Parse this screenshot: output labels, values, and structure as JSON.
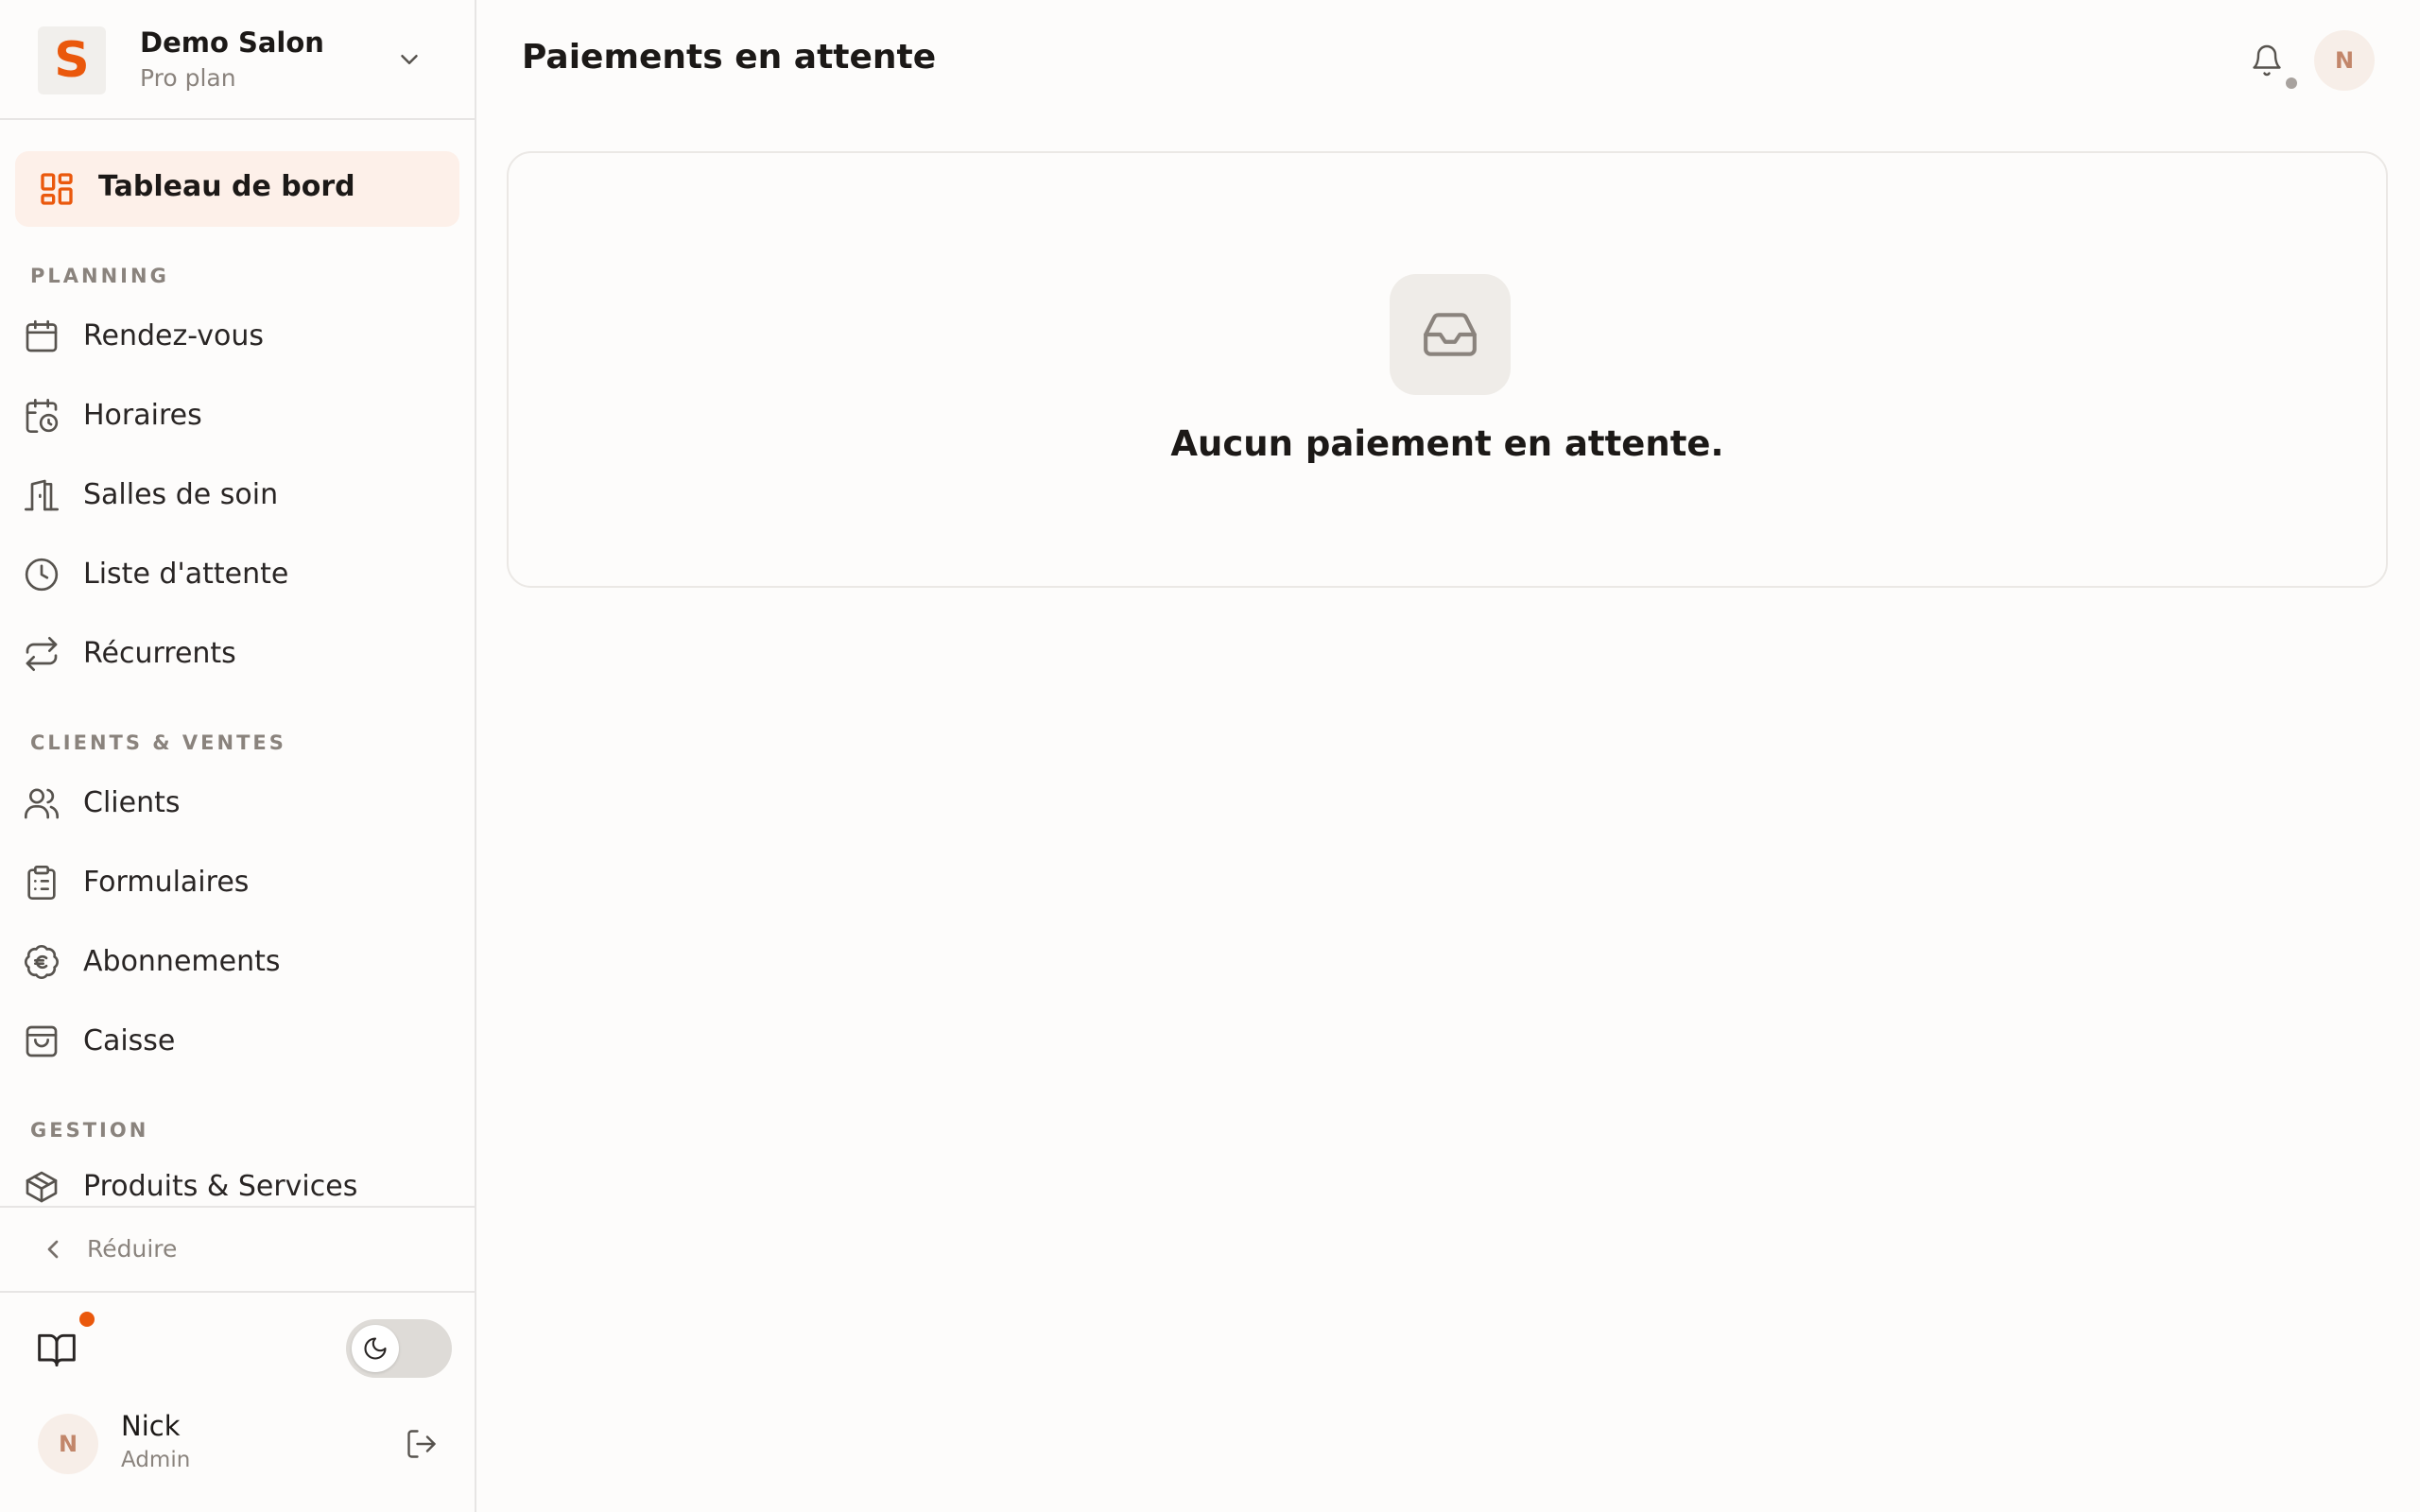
{
  "colors": {
    "accent": "#ea580c",
    "active_bg": "#fdf0e9",
    "muted_text": "#8a837d",
    "border": "#e7e5e4"
  },
  "brand": {
    "logo_letter": "S",
    "name": "Demo Salon",
    "plan": "Pro plan",
    "chevron_icon": "chevron-down-icon"
  },
  "sidebar": {
    "active_item": {
      "label": "Tableau de bord",
      "icon": "dashboard-icon"
    },
    "sections": [
      {
        "title": "PLANNING",
        "items": [
          {
            "label": "Rendez-vous",
            "icon": "calendar-icon"
          },
          {
            "label": "Horaires",
            "icon": "calendar-clock-icon"
          },
          {
            "label": "Salles de soin",
            "icon": "door-icon"
          },
          {
            "label": "Liste d'attente",
            "icon": "clock-icon"
          },
          {
            "label": "Récurrents",
            "icon": "repeat-icon"
          }
        ]
      },
      {
        "title": "CLIENTS & VENTES",
        "items": [
          {
            "label": "Clients",
            "icon": "users-icon"
          },
          {
            "label": "Formulaires",
            "icon": "clipboard-icon"
          },
          {
            "label": "Abonnements",
            "icon": "euro-badge-icon"
          },
          {
            "label": "Caisse",
            "icon": "shopping-bag-icon"
          }
        ]
      },
      {
        "title": "GESTION",
        "items": [
          {
            "label": "Produits & Services",
            "icon": "package-icon"
          }
        ]
      }
    ],
    "collapse_label": "Réduire"
  },
  "footer": {
    "book_icon": "book-open-icon",
    "theme_icon": "moon-icon",
    "user": {
      "initial": "N",
      "name": "Nick",
      "role": "Admin"
    },
    "logout_icon": "logout-icon"
  },
  "header": {
    "title": "Paiements en attente",
    "bell_icon": "bell-icon",
    "avatar_initial": "N"
  },
  "main": {
    "empty_icon": "inbox-icon",
    "empty_message": "Aucun paiement en attente."
  }
}
